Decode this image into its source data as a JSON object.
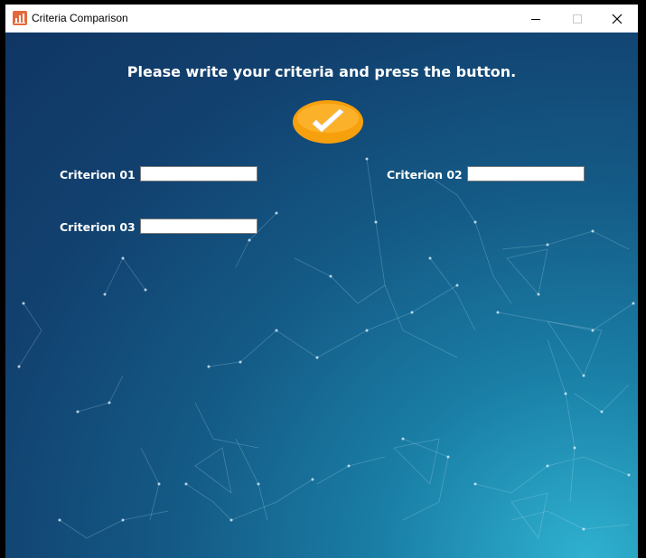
{
  "window": {
    "title": "Criteria Comparison"
  },
  "icons": {
    "app": "chart-icon",
    "minimize": "minimize-icon",
    "maximize": "maximize-icon",
    "close": "close-icon",
    "submit": "checkmark-icon"
  },
  "colors": {
    "accent_button": "#f7a00e",
    "background_dark": "#103664",
    "background_light": "#2fb1cf",
    "app_icon": "#e4693c"
  },
  "main": {
    "instruction": "Please write your criteria and press the button.",
    "criteria": [
      {
        "label": "Criterion 01",
        "value": ""
      },
      {
        "label": "Criterion 02",
        "value": ""
      },
      {
        "label": "Criterion 03",
        "value": ""
      }
    ]
  }
}
